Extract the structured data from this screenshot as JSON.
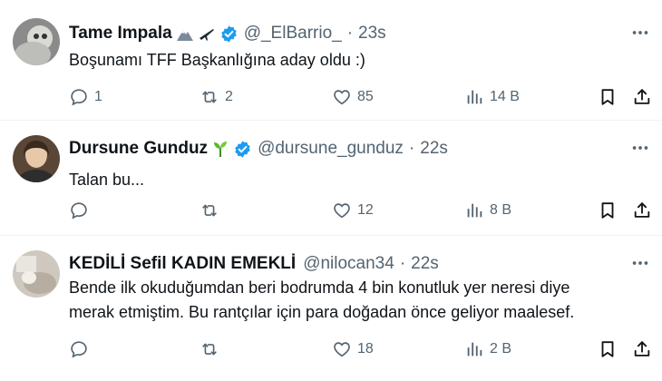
{
  "tweets": [
    {
      "name": "Tame Impala",
      "handle": "@_ElBarrio_",
      "time": "23s",
      "text": "Boşunamı TFF Başkanlığına aday oldu :)",
      "replies": "1",
      "retweets": "2",
      "likes": "85",
      "views": "14 B"
    },
    {
      "name": "Dursune Gunduz",
      "handle": "@dursune_gunduz",
      "time": "22s",
      "text": "Talan bu...",
      "replies": "",
      "retweets": "",
      "likes": "12",
      "views": "8 B"
    },
    {
      "name": "KEDİLİ Sefil KADIN EMEKLİ",
      "handle": "@nilocan34",
      "time": "22s",
      "text_line1": "Bende ilk okuduğumdan beri bodrumda 4 bin konutluk yer neresi diye",
      "text_line2": "merak etmiştim. Bu rantçılar için para doğadan önce geliyor maalesef.",
      "replies": "",
      "retweets": "",
      "likes": "18",
      "views": "2 B"
    }
  ],
  "separator": "·",
  "colors": {
    "text": "#0f1419",
    "secondary": "#536471",
    "verified": "#1d9bf0",
    "divider": "#eff3f4"
  },
  "icons": [
    "reply-icon",
    "retweet-icon",
    "like-icon",
    "views-icon",
    "bookmark-icon",
    "share-icon",
    "more-icon",
    "verified-icon"
  ]
}
